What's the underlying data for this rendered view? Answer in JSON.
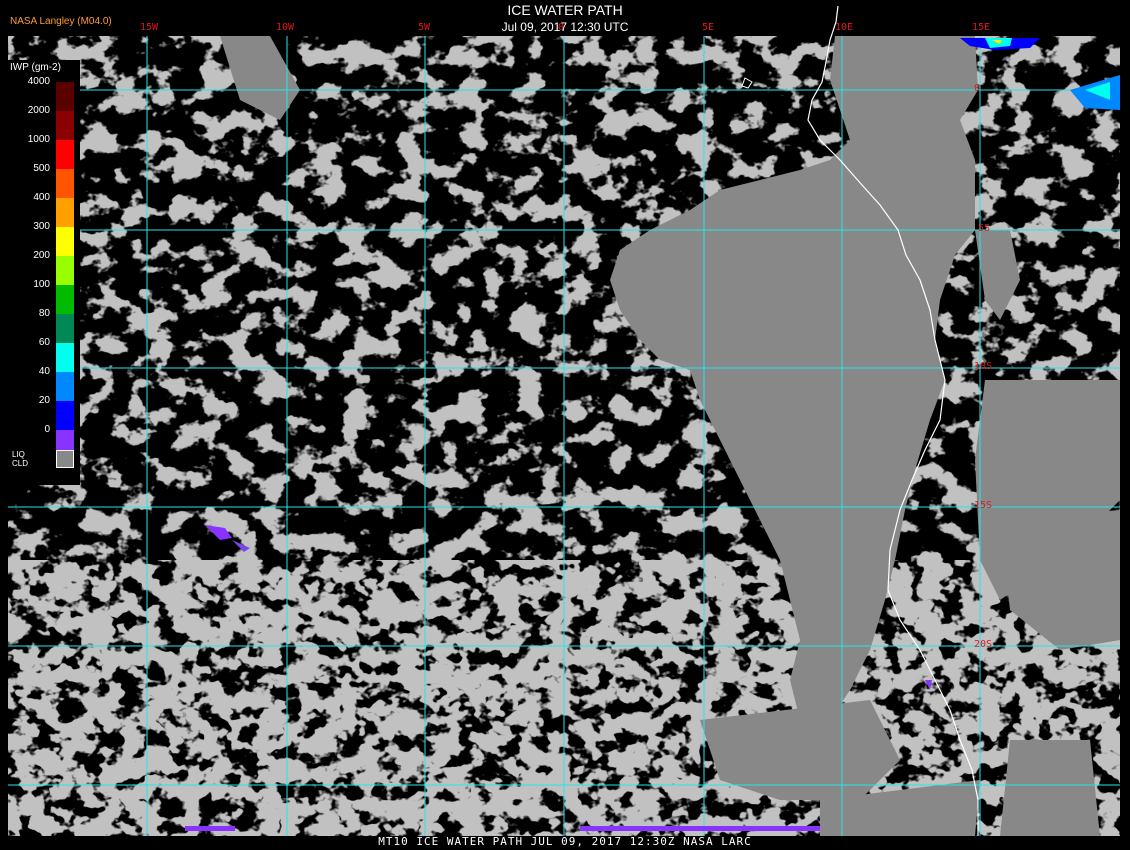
{
  "title": "ICE WATER PATH",
  "datetime": "Jul 09, 2017 12:30 UTC",
  "credit": "NASA Langley (M04.0)",
  "footer": "MT10  ICE WATER PATH  JUL 09, 2017 12:30Z  NASA LARC",
  "legend": {
    "title": "IWP (gm-2)",
    "ticks": [
      "4000",
      "2000",
      "1000",
      "500",
      "400",
      "300",
      "200",
      "100",
      "80",
      "60",
      "40",
      "20",
      "0"
    ],
    "colors": [
      "#5a0000",
      "#8b0000",
      "#ff0000",
      "#ff5500",
      "#ffa000",
      "#ffff00",
      "#99ff00",
      "#00bb00",
      "#008855",
      "#00ffee",
      "#0088ff",
      "#0000ff",
      "#8833ff"
    ],
    "liq_label_1": "LIQ",
    "liq_label_2": "CLD",
    "liq_color": "#888888"
  },
  "colors": {
    "cloud_gray": "#888888",
    "grid": "#23e6ec",
    "labels": "#e0191b",
    "coast": "#ffffff"
  },
  "grid": {
    "lon_labels": [
      "15W",
      "10W",
      "5W",
      "0",
      "5E",
      "10E",
      "15E"
    ],
    "lat_labels": [
      "0",
      "5S",
      "10S",
      "15S",
      "20S"
    ]
  }
}
